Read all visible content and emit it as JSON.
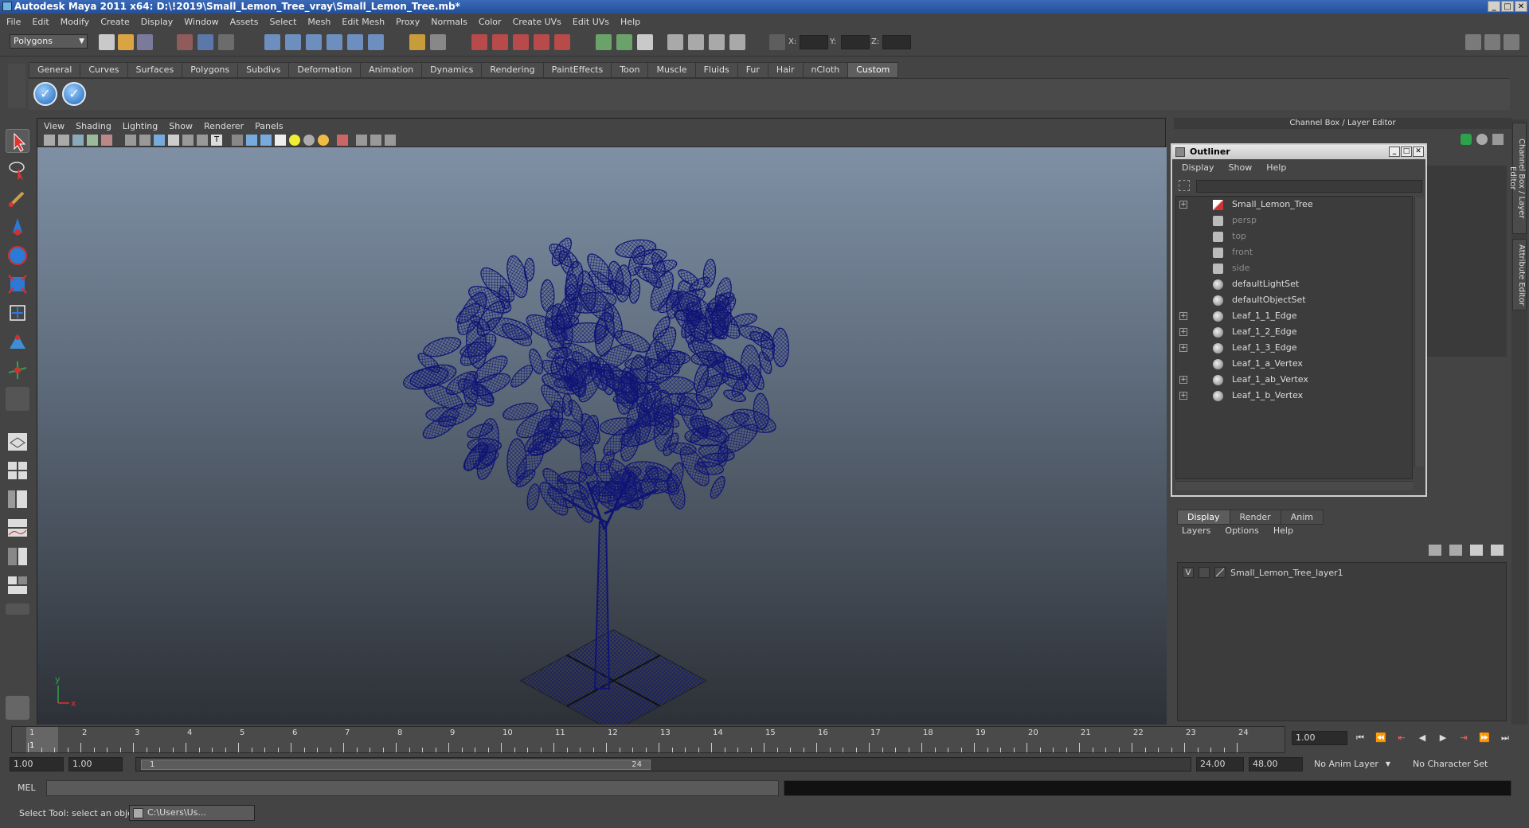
{
  "window": {
    "title": "Autodesk Maya 2011 x64: D:\\!2019\\Small_Lemon_Tree_vray\\Small_Lemon_Tree.mb*"
  },
  "menubar": [
    "File",
    "Edit",
    "Modify",
    "Create",
    "Display",
    "Window",
    "Assets",
    "Select",
    "Mesh",
    "Edit Mesh",
    "Proxy",
    "Normals",
    "Color",
    "Create UVs",
    "Edit UVs",
    "Help"
  ],
  "statusline": {
    "mode": "Polygons",
    "x_label": "X:",
    "y_label": "Y:",
    "z_label": "Z:"
  },
  "shelf": {
    "tabs": [
      "General",
      "Curves",
      "Surfaces",
      "Polygons",
      "Subdivs",
      "Deformation",
      "Animation",
      "Dynamics",
      "Rendering",
      "PaintEffects",
      "Toon",
      "Muscle",
      "Fluids",
      "Fur",
      "Hair",
      "nCloth",
      "Custom"
    ],
    "active_tab": "Custom"
  },
  "viewport": {
    "menu": [
      "View",
      "Shading",
      "Lighting",
      "Show",
      "Renderer",
      "Panels"
    ],
    "axis_y": "y",
    "axis_x": "x",
    "wire_color": "#0f1475"
  },
  "channel_box": {
    "title": "Channel Box / Layer Editor"
  },
  "outliner": {
    "title": "Outliner",
    "menu": [
      "Display",
      "Show",
      "Help"
    ],
    "items": [
      {
        "label": "Small_Lemon_Tree",
        "expandable": true,
        "dim": false,
        "icon": "transform-icon"
      },
      {
        "label": "persp",
        "expandable": false,
        "dim": true,
        "icon": "camera-icon"
      },
      {
        "label": "top",
        "expandable": false,
        "dim": true,
        "icon": "camera-icon"
      },
      {
        "label": "front",
        "expandable": false,
        "dim": true,
        "icon": "camera-icon"
      },
      {
        "label": "side",
        "expandable": false,
        "dim": true,
        "icon": "camera-icon"
      },
      {
        "label": "defaultLightSet",
        "expandable": false,
        "dim": false,
        "icon": "set-icon"
      },
      {
        "label": "defaultObjectSet",
        "expandable": false,
        "dim": false,
        "icon": "set-icon"
      },
      {
        "label": "Leaf_1_1_Edge",
        "expandable": true,
        "dim": false,
        "icon": "set-icon"
      },
      {
        "label": "Leaf_1_2_Edge",
        "expandable": true,
        "dim": false,
        "icon": "set-icon"
      },
      {
        "label": "Leaf_1_3_Edge",
        "expandable": true,
        "dim": false,
        "icon": "set-icon"
      },
      {
        "label": "Leaf_1_a_Vertex",
        "expandable": false,
        "dim": false,
        "icon": "set-icon"
      },
      {
        "label": "Leaf_1_ab_Vertex",
        "expandable": true,
        "dim": false,
        "icon": "set-icon"
      },
      {
        "label": "Leaf_1_b_Vertex",
        "expandable": true,
        "dim": false,
        "icon": "set-icon"
      }
    ]
  },
  "layer_editor": {
    "tabs": [
      "Display",
      "Render",
      "Anim"
    ],
    "active_tab": "Display",
    "menu": [
      "Layers",
      "Options",
      "Help"
    ],
    "layers": [
      {
        "visible": "V",
        "name": "Small_Lemon_Tree_layer1"
      }
    ]
  },
  "side_tabs": [
    "Channel Box / Layer Editor",
    "Attribute Editor"
  ],
  "timeline": {
    "ticks": [
      "1",
      "2",
      "3",
      "4",
      "5",
      "6",
      "7",
      "8",
      "9",
      "10",
      "11",
      "12",
      "13",
      "14",
      "15",
      "16",
      "17",
      "18",
      "19",
      "20",
      "21",
      "22",
      "23",
      "24"
    ],
    "current_frame_marker": "1",
    "current_frame": "1.00"
  },
  "range": {
    "start": "1.00",
    "playback_start": "1.00",
    "thumb_start": "1",
    "thumb_end": "24",
    "playback_end": "24.00",
    "end": "48.00",
    "anim_layer": "No Anim Layer",
    "character_set": "No Character Set"
  },
  "command_line": {
    "label": "MEL"
  },
  "help_line": {
    "text": "Select Tool: select an object",
    "task": "C:\\Users\\Us..."
  }
}
